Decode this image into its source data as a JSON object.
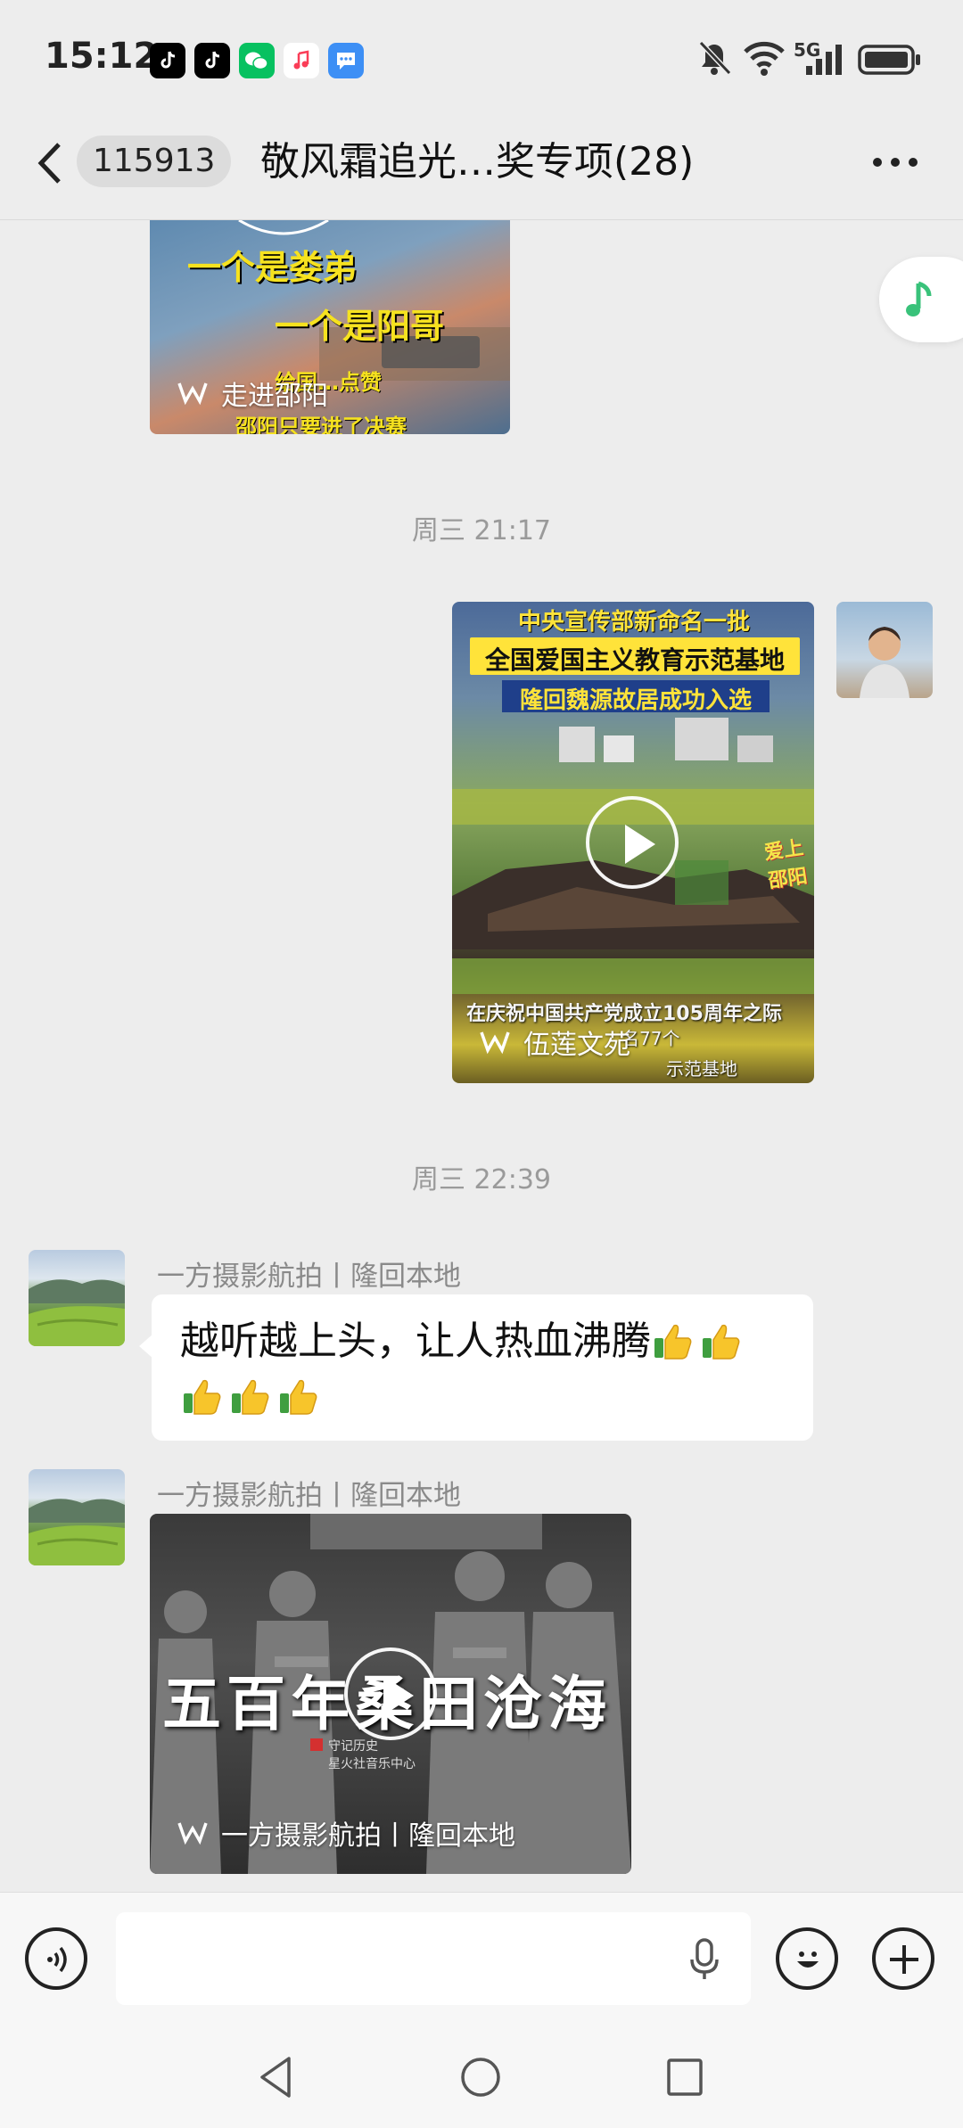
{
  "status_bar": {
    "time": "15:12",
    "network": "5G",
    "apps": [
      "tiktok-icon",
      "tiktok-icon",
      "wechat-icon",
      "music-icon",
      "message-icon"
    ],
    "right_icons": [
      "mute-icon",
      "wifi-icon",
      "signal-icon",
      "battery-icon"
    ]
  },
  "nav": {
    "unread_count": "115913",
    "title": "敬风霜追光…奖专项(28)"
  },
  "messages": [
    {
      "type": "video-card",
      "position": "left",
      "source": "走进邵阳",
      "overlay_texts": [
        "一个是娄弟",
        "一个是阳哥",
        "给国…点赞",
        "邵阳只要进了决赛"
      ]
    },
    {
      "type": "timestamp",
      "text": "周三 21:17"
    },
    {
      "type": "video-card",
      "position": "right",
      "source": "伍莲文苑",
      "overlay_texts": [
        "中央宣传部新命名一批",
        "全国爱国主义教育示范基地",
        "隆回魏源故居成功入选",
        "在庆祝中国共产党成立105周年之际",
        "名77个",
        "示范基地",
        "爱上邵阳"
      ]
    },
    {
      "type": "timestamp",
      "text": "周三 22:39"
    },
    {
      "type": "text",
      "position": "left",
      "sender": "一方摄影航拍丨隆回本地",
      "text": "越听越上头，让人热血沸腾",
      "emoji_count": 5
    },
    {
      "type": "video-card",
      "position": "left",
      "sender": "一方摄影航拍丨隆回本地",
      "source": "一方摄影航拍丨隆回本地",
      "overlay_texts": [
        "五百年桑田沧海",
        "守记历史",
        "星火社音乐中心"
      ]
    }
  ],
  "colors": {
    "background": "#ededed",
    "bubble": "#ffffff",
    "accent_green": "#07c160",
    "timestamp": "#9a9a9a"
  }
}
